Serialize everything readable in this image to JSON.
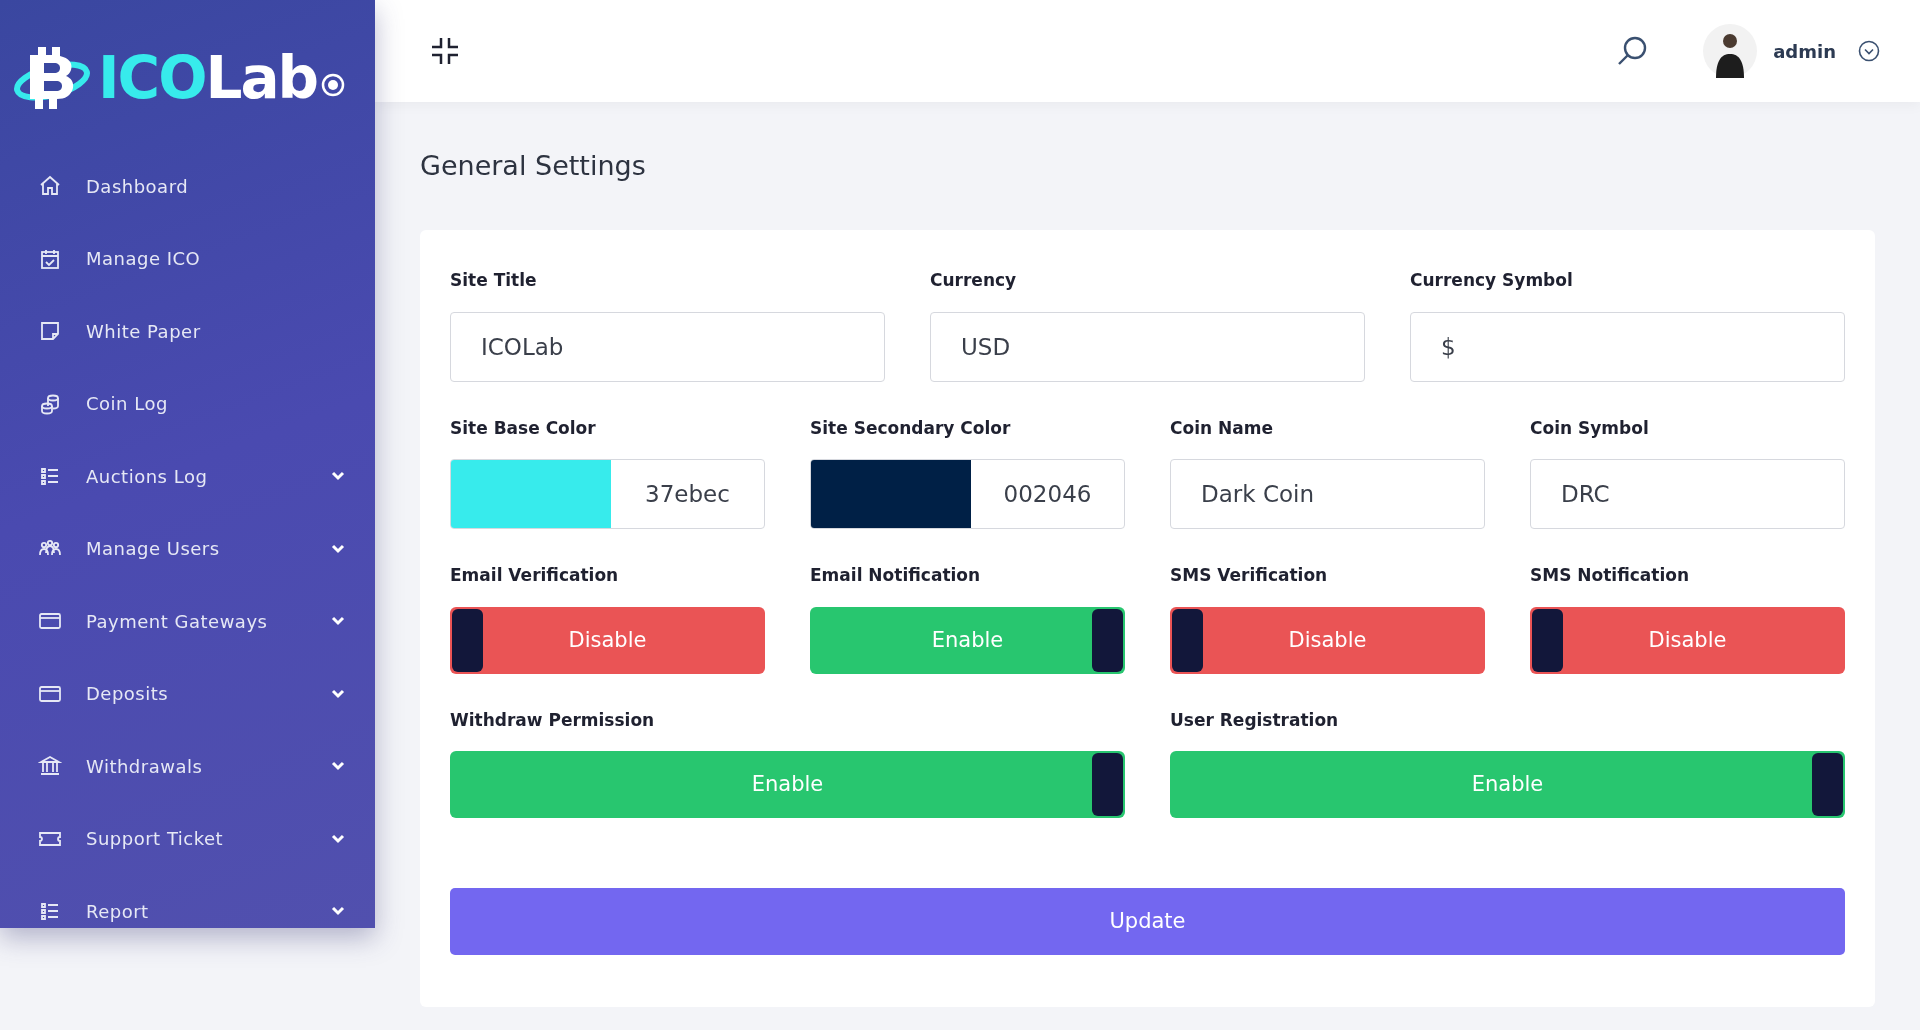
{
  "logo": {
    "accent": "ICO",
    "rest": "Lab"
  },
  "sidebar": {
    "items": [
      {
        "label": "Dashboard",
        "has_submenu": false
      },
      {
        "label": "Manage ICO",
        "has_submenu": false
      },
      {
        "label": "White Paper",
        "has_submenu": false
      },
      {
        "label": "Coin Log",
        "has_submenu": false
      },
      {
        "label": "Auctions Log",
        "has_submenu": true
      },
      {
        "label": "Manage Users",
        "has_submenu": true
      },
      {
        "label": "Payment Gateways",
        "has_submenu": true
      },
      {
        "label": "Deposits",
        "has_submenu": true
      },
      {
        "label": "Withdrawals",
        "has_submenu": true
      },
      {
        "label": "Support Ticket",
        "has_submenu": true
      },
      {
        "label": "Report",
        "has_submenu": true
      }
    ]
  },
  "header": {
    "user": "admin"
  },
  "page_title": "General Settings",
  "form": {
    "row_1": [
      {
        "label": "Site Title",
        "kind": "text",
        "value": "ICOLab"
      },
      {
        "label": "Currency",
        "kind": "text",
        "value": "USD"
      },
      {
        "label": "Currency Symbol",
        "kind": "text",
        "value": "$"
      }
    ],
    "row_2": [
      {
        "label": "Site Base Color",
        "kind": "color",
        "value": "37ebec",
        "color": "#37ebec"
      },
      {
        "label": "Site Secondary Color",
        "kind": "color",
        "value": "002046",
        "color": "#002046"
      },
      {
        "label": "Coin Name",
        "kind": "text",
        "value": "Dark Coin"
      },
      {
        "label": "Coin Symbol",
        "kind": "text",
        "value": "DRC"
      }
    ],
    "row_3": [
      {
        "label": "Email Verification",
        "kind": "toggle",
        "on": false,
        "value": "Disable"
      },
      {
        "label": "Email Notification",
        "kind": "toggle",
        "on": true,
        "value": "Enable"
      },
      {
        "label": "SMS Verification",
        "kind": "toggle",
        "on": false,
        "value": "Disable"
      },
      {
        "label": "SMS Notification",
        "kind": "toggle",
        "on": false,
        "value": "Disable"
      }
    ],
    "row_4": [
      {
        "label": "Withdraw Permission",
        "kind": "toggle",
        "on": true,
        "value": "Enable"
      },
      {
        "label": "User Registration",
        "kind": "toggle",
        "on": true,
        "value": "Enable"
      }
    ],
    "submit": "Update"
  }
}
